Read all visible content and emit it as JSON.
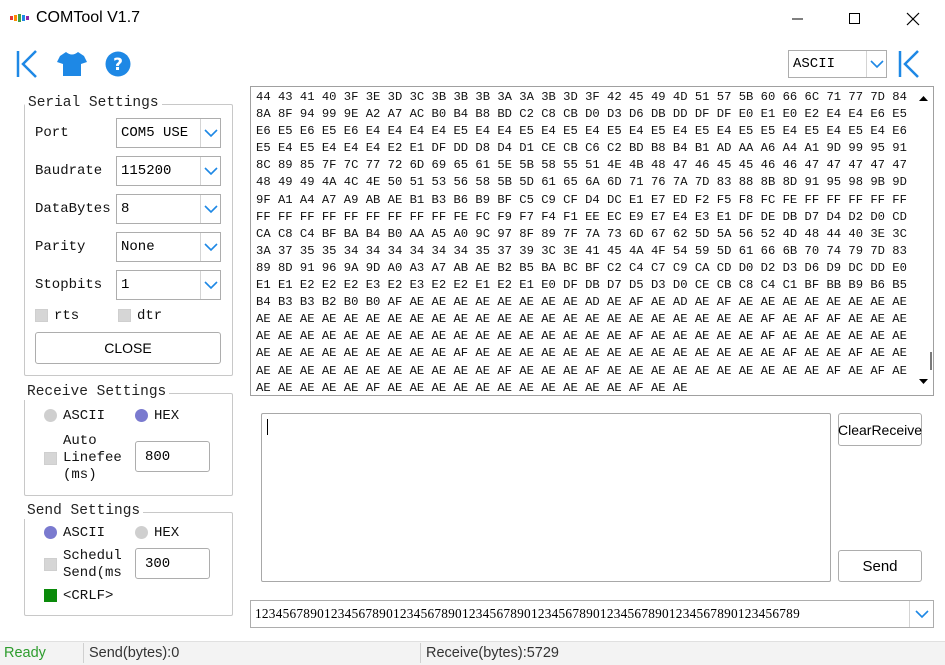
{
  "app": {
    "title": "COMTool V1.7"
  },
  "toolbar": {
    "encoding_selected": "ASCII"
  },
  "serial_settings": {
    "title": "Serial Settings",
    "port": {
      "label": "Port",
      "value": "COM5 USE"
    },
    "baudrate": {
      "label": "Baudrate",
      "value": "115200"
    },
    "databytes": {
      "label": "DataBytes",
      "value": "8"
    },
    "parity": {
      "label": "Parity",
      "value": "None"
    },
    "stopbits": {
      "label": "Stopbits",
      "value": "1"
    },
    "rts_label": "rts",
    "dtr_label": "dtr",
    "close_label": "CLOSE"
  },
  "receive_settings": {
    "title": "Receive Settings",
    "ascii_label": "ASCII",
    "hex_label": "HEX",
    "selected": "HEX",
    "auto_linefeed_line1": "Auto",
    "auto_linefeed_line2": "Linefee",
    "auto_linefeed_line3": "(ms)",
    "auto_linefeed_value": "800"
  },
  "send_settings": {
    "title": "Send Settings",
    "ascii_label": "ASCII",
    "hex_label": "HEX",
    "selected": "ASCII",
    "schedule_line1": "Schedul",
    "schedule_line2": "Send(ms",
    "schedule_value": "300",
    "crlf_label": "<CRLF>"
  },
  "receive": {
    "text": "44 43 41 40 3F 3E 3D 3C 3B 3B 3B 3A 3A 3B 3D 3F 42 45 49 4D 51 57 5B 60 66 6C 71 77 7D 84 8A 8F 94 99 9E A2 A7 AC B0 B4 B8 BD C2 C8 CB D0 D3 D6 DB DD DF DF E0 E1 E0 E2 E4 E4 E6 E5 E6 E5 E6 E5 E6 E4 E4 E4 E4 E5 E4 E4 E5 E4 E5 E4 E5 E4 E5 E4 E5 E4 E5 E5 E4 E5 E4 E5 E4 E6 E5 E4 E5 E4 E4 E4 E2 E1 DF DD D8 D4 D1 CE CB C6 C2 BD B8 B4 B1 AD AA A6 A4 A1 9D 99 95 91 8C 89 85 7F 7C 77 72 6D 69 65 61 5E 5B 58 55 51 4E 4B 48 47 46 45 45 46 46 47 47 47 47 47 48 49 49 4A 4C 4E 50 51 53 56 58 5B 5D 61 65 6A 6D 71 76 7A 7D 83 88 8B 8D 91 95 98 9B 9D 9F A1 A4 A7 A9 AB AE B1 B3 B6 B9 BF C5 C9 CF D4 DC E1 E7 ED F2 F5 F8 FC FE FF FF FF FF FF FF FF FF FF FF FF FF FF FF FE FC F9 F7 F4 F1 EE EC E9 E7 E4 E3 E1 DF DE DB D7 D4 D2 D0 CD CA C8 C4 BF BA B4 B0 AA A5 A0 9C 97 8F 89 7F 7A 73 6D 67 62 5D 5A 56 52 4D 48 44 40 3E 3C 3A 37 35 35 34 34 34 34 34 34 35 37 39 3C 3E 41 45 4A 4F 54 59 5D 61 66 6B 70 74 79 7D 83 89 8D 91 96 9A 9D A0 A3 A7 AB AE B2 B5 BA BC BF C2 C4 C7 C9 CA CD D0 D2 D3 D6 D9 DC DD E0 E1 E1 E2 E2 E2 E3 E2 E3 E2 E2 E1 E2 E1 E0 DF DB D7 D5 D3 D0 CE CB C8 C4 C1 BF BB B9 B6 B5 B4 B3 B3 B2 B0 B0 AF AE AE AE AE AE AE AE AE AD AE AF AE AD AE AF AE AE AE AE AE AE AE AE AE AE AE AE AE AE AE AE AE AE AE AE AE AE AE AE AE AE AE AE AE AE AE AF AE AF AF AE AE AE AE AE AE AE AE AE AE AE AE AE AE AE AE AE AE AE AE AF AE AE AE AE AE AF AE AE AE AE AE AE AE AE AE AE AE AE AE AE AE AF AE AE AE AE AE AE AE AE AE AE AE AE AE AE AF AE AE AF AE AE AE AE AE AE AE AE AE AE AE AE AE AF AE AE AE AF AE AE AE AE AE AE AE AE AE AE AF AE AF AE AE AE AE AE AE AF AE AE AE AE AE AE AE AE AE AE AE AF AE AE",
    "clear_label": "ClearReceive"
  },
  "send": {
    "text": "",
    "send_label": "Send",
    "history_value": "1234567890123456789012345678901234567890123456789012345678901234567890123456789"
  },
  "status": {
    "state": "Ready",
    "send_bytes": "Send(bytes):0",
    "receive_bytes": "Receive(bytes):5729"
  },
  "colors": {
    "accent": "#1e88e5",
    "ready_green": "#2e9c2e",
    "radio_selected": "#7a7acf",
    "crlf_green": "#0a8a0a"
  }
}
